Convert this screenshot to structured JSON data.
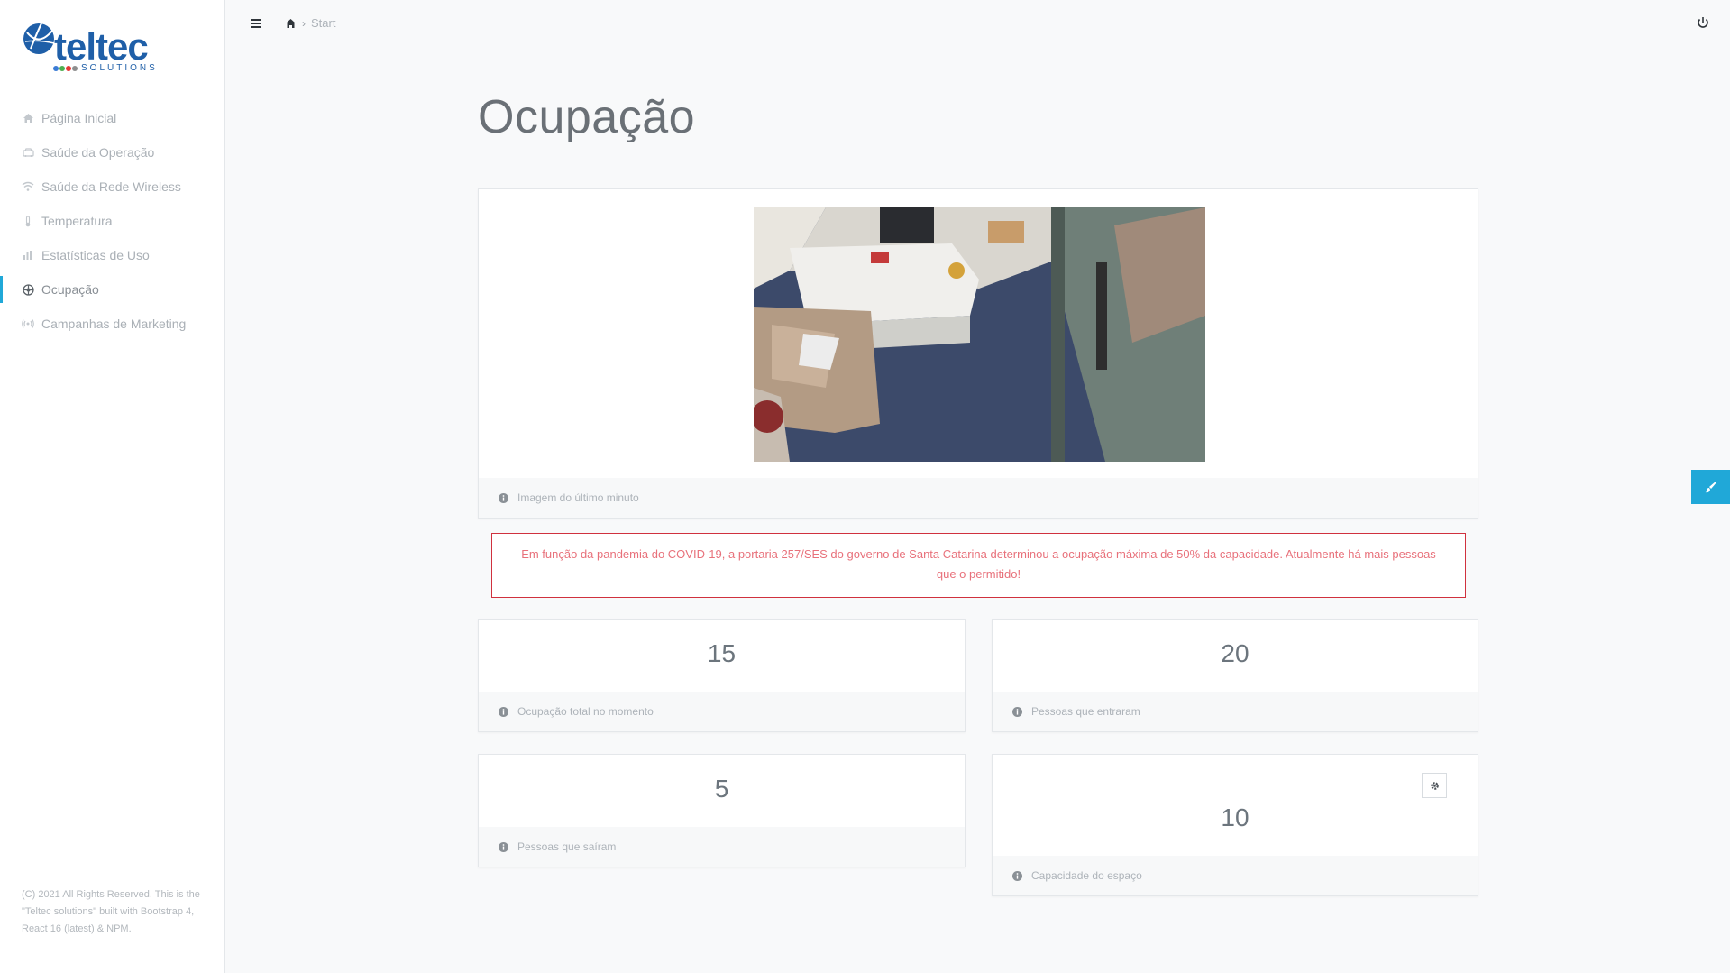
{
  "app": {
    "logo_text": "teltec",
    "logo_sub": "SOLUTIONS"
  },
  "sidebar": {
    "items": [
      {
        "label": "Página Inicial",
        "icon": "home-icon"
      },
      {
        "label": "Saúde da Operação",
        "icon": "car-icon"
      },
      {
        "label": "Saúde da Rede Wireless",
        "icon": "wifi-icon"
      },
      {
        "label": "Temperatura",
        "icon": "thermometer-icon"
      },
      {
        "label": "Estatísticas de Uso",
        "icon": "bar-chart-icon"
      },
      {
        "label": "Ocupação",
        "icon": "gear-circle-icon",
        "active": true
      },
      {
        "label": "Campanhas de Marketing",
        "icon": "broadcast-icon"
      }
    ],
    "footer": "(C) 2021 All Rights Reserved. This is the \"Teltec solutions\" built with Bootstrap 4, React 16 (latest) & NPM."
  },
  "topbar": {
    "breadcrumb": "Start"
  },
  "page": {
    "title": "Ocupação"
  },
  "camera_card": {
    "caption": "Imagem do último minuto"
  },
  "alert": {
    "text": "Em função da pandemia do COVID-19, a portaria 257/SES do governo de Santa Catarina determinou a ocupação máxima de 50% da capacidade. Atualmente há mais pessoas que o permitido!"
  },
  "stats": {
    "current": {
      "value": "15",
      "label": "Ocupação total no momento"
    },
    "entered": {
      "value": "20",
      "label": "Pessoas que entraram"
    },
    "left": {
      "value": "5",
      "label": "Pessoas que saíram"
    },
    "capacity": {
      "value": "10",
      "label": "Capacidade do espaço"
    }
  },
  "colors": {
    "accent": "#20a8d8",
    "alert_border": "#d0313e",
    "alert_text": "#e8717b",
    "logo_blue": "#1f5fa8"
  }
}
